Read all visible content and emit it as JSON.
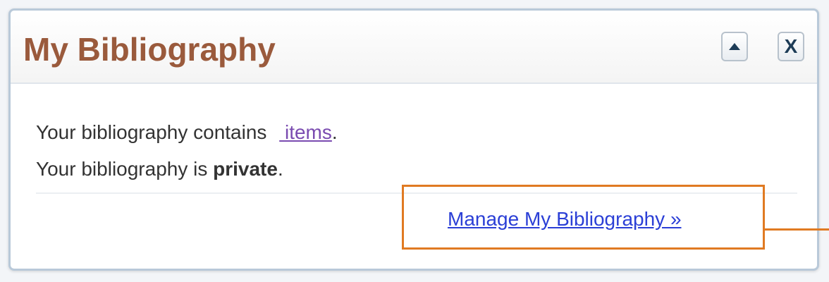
{
  "panel": {
    "title": "My Bibliography",
    "close_label": "X"
  },
  "body": {
    "line1_prefix": "Your bibliography contains ",
    "item_count": "",
    "items_label": "items",
    "line1_suffix": ".",
    "line2_prefix": "Your bibliography is ",
    "visibility": "private",
    "line2_suffix": "."
  },
  "footer": {
    "manage_link": "Manage My Bibliography »"
  },
  "icons": {
    "collapse": "triangle-up-icon",
    "close": "close-icon"
  },
  "colors": {
    "title": "#9a5a3c",
    "link": "#2b3fd6",
    "visited_link": "#7a4bb0",
    "highlight": "#e07a22"
  }
}
